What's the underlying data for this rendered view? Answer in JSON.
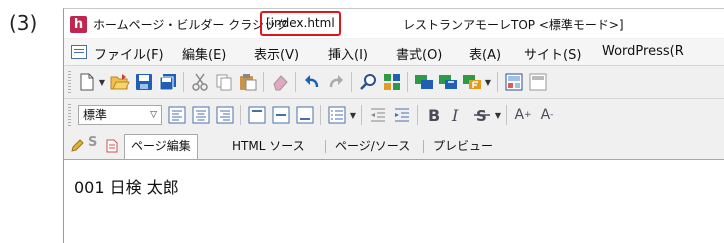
{
  "step_label": "(3)",
  "window": {
    "app_icon_letter": "h",
    "title_app": "ホームページ・ビルダー クラシック",
    "title_file": "[index.html",
    "title_doc": "レストランアモーレTOP <標準モード>]"
  },
  "menu": [
    {
      "label": "ファイル(F)"
    },
    {
      "label": "編集(E)"
    },
    {
      "label": "表示(V)"
    },
    {
      "label": "挿入(I)"
    },
    {
      "label": "書式(O)"
    },
    {
      "label": "表(A)"
    },
    {
      "label": "サイト(S)"
    },
    {
      "label": "WordPress(R"
    }
  ],
  "toolbar2": {
    "style_select_value": "標準",
    "superscript_label": "A",
    "superscript_sign": "+",
    "subscript_label": "A",
    "subscript_sign": "-"
  },
  "tabs": [
    {
      "label": "ページ編集",
      "active": true
    },
    {
      "label": "HTML ソース",
      "active": false
    },
    {
      "label": "ページ/ソース",
      "active": false
    },
    {
      "label": "プレビュー",
      "active": false
    }
  ],
  "content": {
    "line1": "001  日検  太郎"
  },
  "colors": {
    "app_icon": "#c0264f",
    "highlight_border": "#e0141b",
    "icon_blue": "#1f5fb4",
    "icon_green": "#2f9a45",
    "icon_orange": "#e59a22"
  }
}
